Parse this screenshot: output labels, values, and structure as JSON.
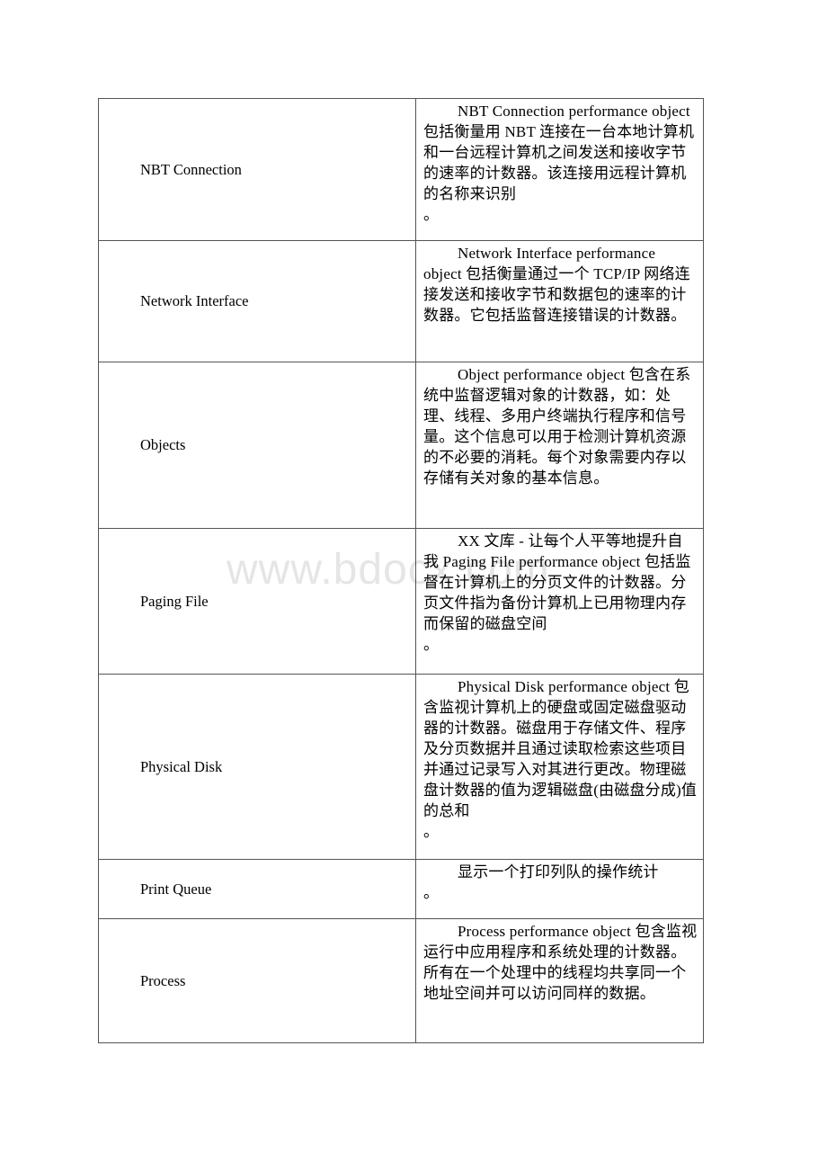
{
  "table": {
    "rows": [
      {
        "name": "NBT Connection",
        "description": "NBT Connection performance object 包括衡量用 NBT 连接在一台本地计算机和一台远程计算机之间发送和接收字节的速率的计数器。该连接用远程计算机的名称来识别",
        "trailing_period": "。"
      },
      {
        "name": "Network Interface",
        "description": "Network Interface performance object 包括衡量通过一个 TCP/IP 网络连接发送和接收字节和数据包的速率的计数器。它包括监督连接错误的计数器。",
        "trailing_period": ""
      },
      {
        "name": "Objects",
        "description": "Object performance object 包含在系统中监督逻辑对象的计数器，如：处理、线程、多用户终端执行程序和信号量。这个信息可以用于检测计算机资源的不必要的消耗。每个对象需要内存以存储有关对象的基本信息。",
        "trailing_period": ""
      },
      {
        "name": "Paging File",
        "description": "XX 文库 - 让每个人平等地提升自我 Paging File performance object 包括监督在计算机上的分页文件的计数器。分页文件指为备份计算机上已用物理内存而保留的磁盘空间",
        "trailing_period": "。"
      },
      {
        "name": "Physical Disk",
        "description": "Physical Disk performance object 包含监视计算机上的硬盘或固定磁盘驱动器的计数器。磁盘用于存储文件、程序及分页数据并且通过读取检索这些项目并通过记录写入对其进行更改。物理磁盘计数器的值为逻辑磁盘(由磁盘分成)值的总和",
        "trailing_period": "。"
      },
      {
        "name": "Print Queue",
        "description": "显示一个打印列队的操作统计",
        "trailing_period": "。"
      },
      {
        "name": "Process",
        "description": "Process performance object 包含监视运行中应用程序和系统处理的计数器。所有在一个处理中的线程均共享同一个地址空间并可以访问同样的数据。",
        "trailing_period": ""
      }
    ]
  },
  "watermark": "www.bdocx.com"
}
